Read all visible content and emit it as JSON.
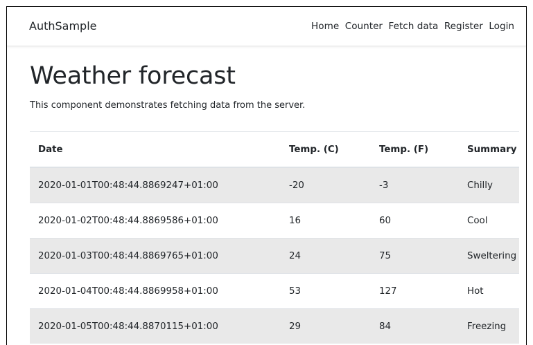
{
  "navbar": {
    "brand": "AuthSample",
    "links": [
      "Home",
      "Counter",
      "Fetch data",
      "Register",
      "Login"
    ]
  },
  "page": {
    "title": "Weather forecast",
    "description": "This component demonstrates fetching data from the server."
  },
  "table": {
    "headers": [
      "Date",
      "Temp. (C)",
      "Temp. (F)",
      "Summary"
    ],
    "rows": [
      [
        "2020-01-01T00:48:44.8869247+01:00",
        "-20",
        "-3",
        "Chilly"
      ],
      [
        "2020-01-02T00:48:44.8869586+01:00",
        "16",
        "60",
        "Cool"
      ],
      [
        "2020-01-03T00:48:44.8869765+01:00",
        "24",
        "75",
        "Sweltering"
      ],
      [
        "2020-01-04T00:48:44.8869958+01:00",
        "53",
        "127",
        "Hot"
      ],
      [
        "2020-01-05T00:48:44.8870115+01:00",
        "29",
        "84",
        "Freezing"
      ]
    ]
  },
  "colors": {
    "stripe": "#e9e9e9",
    "border": "#dee2e6",
    "text": "#212529"
  }
}
